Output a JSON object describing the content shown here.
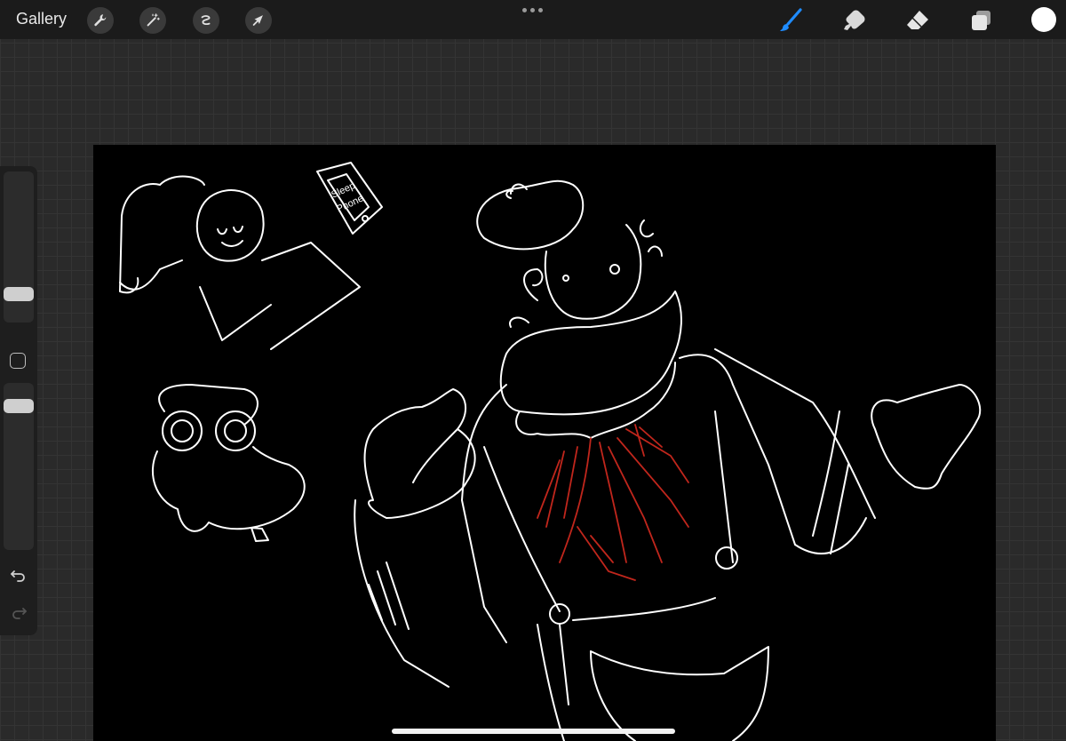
{
  "topbar": {
    "gallery_label": "Gallery",
    "left_tools": [
      {
        "icon": "wrench-icon",
        "label": "Actions"
      },
      {
        "icon": "magic-wand-icon",
        "label": "Adjustments"
      },
      {
        "icon": "selection-icon",
        "label": "Selection"
      },
      {
        "icon": "arrow-cursor-icon",
        "label": "Transform"
      }
    ],
    "more_icon": "more-dots-icon",
    "right_tools": [
      {
        "icon": "brush-icon",
        "active": true
      },
      {
        "icon": "smudge-icon",
        "active": false
      },
      {
        "icon": "eraser-icon",
        "active": false
      },
      {
        "icon": "layers-icon",
        "active": false
      }
    ],
    "current_color": "#ffffff",
    "accent": "#1f8cff"
  },
  "sidebar": {
    "brush_size_level": 0.34,
    "opacity_level": 0.9
  },
  "canvas": {
    "background": "#000000",
    "sketch_text": [
      "Sleep",
      "Phone"
    ]
  }
}
